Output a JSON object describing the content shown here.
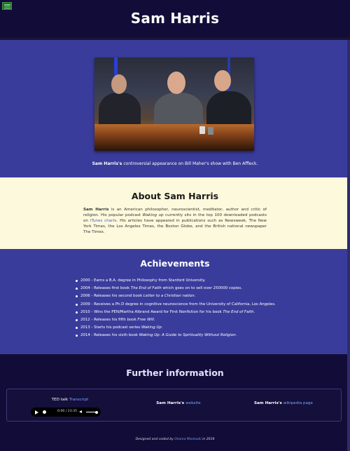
{
  "header": {
    "title": "Sam Harris",
    "menu_icon": "hamburger-menu-icon"
  },
  "hero": {
    "image_alt": "Sam Harris on Bill Maher's show",
    "caption_name": "Sam Harris's",
    "caption_rest": " controversial appearance on Bill Maher's show with Ben Affleck."
  },
  "about": {
    "title": "About Sam Harris",
    "p_name": "Sam Harris",
    "p1": " is an American philosopher, neuroscientist, meditator, author and critic of religion. His popular podcast ",
    "podcast": "Waking up",
    "p2": " currently sits in the top 100 downloaded podcasts on ",
    "itunes_link": "iTunes charts",
    "p3": ". His articles have appeared in publications such as Newsweek, The New York Times, the Los Angeles Times, the Boston Globe, and the British national newspaper The Times."
  },
  "achievements": {
    "title": "Achievements",
    "items": [
      {
        "text": "2000 - Earns a B.A. degree in Philosophy from Stanford University.",
        "em": "",
        "after": ""
      },
      {
        "text": "2004 - Releases first book ",
        "em": "The End of Faith",
        "after": " which goes on to sell over 250000 copies."
      },
      {
        "text": "2006 - Releases his second book ",
        "em": "Letter to a Christian nation",
        "after": "."
      },
      {
        "text": "2009 - Receives a Ph.D degree in cognitive neuroscience from the University of California, Los Angeles.",
        "em": "",
        "after": ""
      },
      {
        "text": "2010 - Wins the PEN/Martha Albrand Award for First Nonfiction for his book ",
        "em": "The End of Faith",
        "after": "."
      },
      {
        "text": "2012 - Releases his fifth book ",
        "em": "Free Will",
        "after": "."
      },
      {
        "text": "2013 - Starts his podcast series ",
        "em": "Waking Up",
        "after": "."
      },
      {
        "text": "2014 - Releases his sixth book ",
        "em": "Waking Up: A Guide to Spirituality Without Religion",
        "after": "."
      }
    ]
  },
  "further": {
    "title": "Further information",
    "ted_label": "TED talk ",
    "transcript_link": "Transcript",
    "player": {
      "time": "0:00 / 23:35",
      "progress": 0,
      "volume": 0.8
    },
    "website_name": "Sam Harris's ",
    "website_link": "website",
    "wiki_name": "Sam Harris's ",
    "wiki_link": "wikipedia page"
  },
  "footer": {
    "text": "Designed and coded by ",
    "author": "Osama Marzouki",
    "year": " in 2018"
  },
  "colors": {
    "header_bg": "#120c38",
    "section_blue": "#3a3c9c",
    "about_bg": "#fdf9dc",
    "link": "#7aa6ff"
  }
}
